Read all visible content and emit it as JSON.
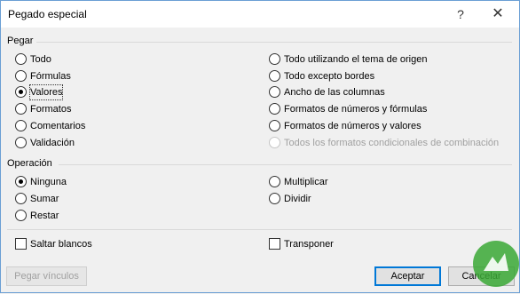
{
  "dialog": {
    "title": "Pegado especial",
    "help_glyph": "?",
    "close_glyph": "✕"
  },
  "pegar": {
    "label": "Pegar",
    "options_left": [
      {
        "label": "Todo",
        "checked": false
      },
      {
        "label": "Fórmulas",
        "checked": false
      },
      {
        "label": "Valores",
        "checked": true
      },
      {
        "label": "Formatos",
        "checked": false
      },
      {
        "label": "Comentarios",
        "checked": false
      },
      {
        "label": "Validación",
        "checked": false
      }
    ],
    "options_right": [
      {
        "label": "Todo utilizando el tema de origen",
        "checked": false,
        "disabled": false
      },
      {
        "label": "Todo excepto bordes",
        "checked": false,
        "disabled": false
      },
      {
        "label": "Ancho de las columnas",
        "checked": false,
        "disabled": false
      },
      {
        "label": "Formatos de números y fórmulas",
        "checked": false,
        "disabled": false
      },
      {
        "label": "Formatos de números y valores",
        "checked": false,
        "disabled": false
      },
      {
        "label": "Todos los formatos condicionales de combinación",
        "checked": false,
        "disabled": true
      }
    ]
  },
  "operacion": {
    "label": "Operación",
    "options_left": [
      {
        "label": "Ninguna",
        "checked": true
      },
      {
        "label": "Sumar",
        "checked": false
      },
      {
        "label": "Restar",
        "checked": false
      }
    ],
    "options_right": [
      {
        "label": "Multiplicar",
        "checked": false
      },
      {
        "label": "Dividir",
        "checked": false
      }
    ]
  },
  "checkboxes": {
    "saltar_blancos": {
      "label": "Saltar blancos",
      "checked": false
    },
    "transponer": {
      "label": "Transponer",
      "checked": false
    }
  },
  "buttons": {
    "pegar_vinculos": "Pegar vínculos",
    "aceptar": "Aceptar",
    "cancelar": "Cancelar"
  },
  "colors": {
    "accent": "#0078d7",
    "logo_green": "#3aa835"
  }
}
